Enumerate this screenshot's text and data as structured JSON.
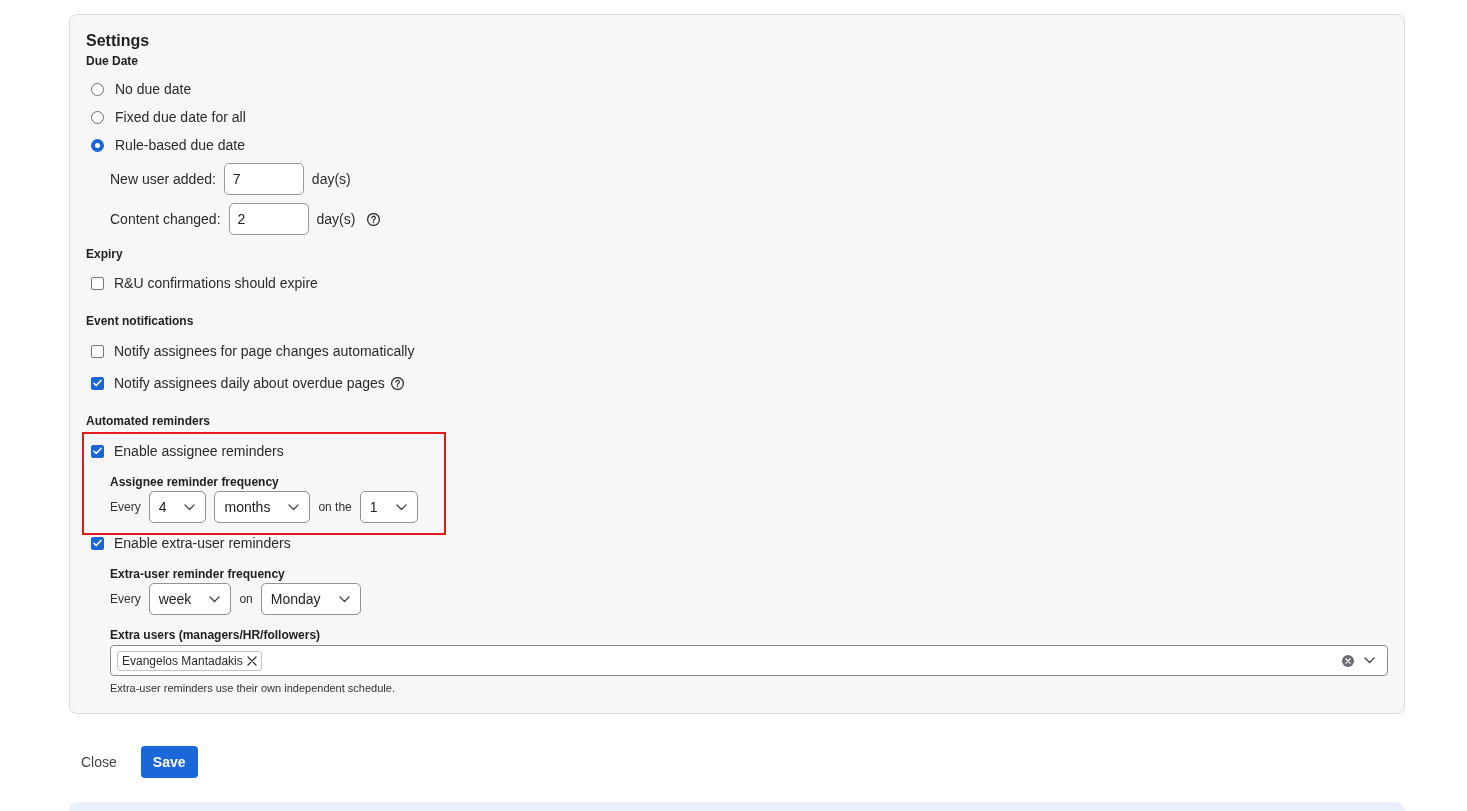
{
  "settings": {
    "title": "Settings",
    "due_date": {
      "heading": "Due Date",
      "options": [
        {
          "label": "No due date",
          "selected": false
        },
        {
          "label": "Fixed due date for all",
          "selected": false
        },
        {
          "label": "Rule-based due date",
          "selected": true
        }
      ],
      "rules": [
        {
          "label": "New user added:",
          "value": "7",
          "unit": "day(s)"
        },
        {
          "label": "Content changed:",
          "value": "2",
          "unit": "day(s)",
          "help": true
        }
      ]
    },
    "expiry": {
      "heading": "Expiry",
      "options": [
        {
          "label": "R&U confirmations should expire",
          "checked": false
        }
      ]
    },
    "event_notifications": {
      "heading": "Event notifications",
      "options": [
        {
          "label": "Notify assignees for page changes automatically",
          "checked": false
        },
        {
          "label": "Notify assignees daily about overdue pages",
          "checked": true,
          "help": true
        }
      ]
    },
    "automated_reminders": {
      "heading": "Automated reminders",
      "groups": [
        {
          "label": "Enable assignee reminders",
          "checked": true,
          "highlighted": true,
          "frequency_heading": "Assignee reminder frequency",
          "frequency": [
            {
              "kind": "text",
              "text": "Every"
            },
            {
              "kind": "select",
              "value": "4"
            },
            {
              "kind": "select",
              "value": "months"
            },
            {
              "kind": "text",
              "text": "on the"
            },
            {
              "kind": "select",
              "value": "1"
            }
          ]
        },
        {
          "label": "Enable extra-user reminders",
          "checked": true,
          "frequency_heading": "Extra-user reminder frequency",
          "frequency": [
            {
              "kind": "text",
              "text": "Every"
            },
            {
              "kind": "select",
              "value": "week"
            },
            {
              "kind": "text",
              "text": "on"
            },
            {
              "kind": "select",
              "value": "Monday"
            }
          ]
        }
      ],
      "extra_users": {
        "label": "Extra users (managers/HR/followers)",
        "chips": [
          {
            "label": "Evangelos Mantadakis"
          }
        ],
        "hint": "Extra-user reminders use their own independent schedule."
      }
    }
  },
  "actions": [
    {
      "kind": "plain",
      "label": "Close"
    },
    {
      "kind": "primary",
      "label": "Save"
    }
  ]
}
